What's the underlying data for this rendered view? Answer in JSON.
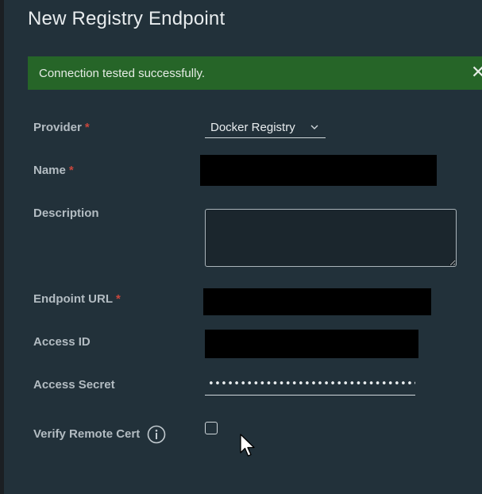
{
  "dialog": {
    "title": "New Registry Endpoint"
  },
  "alert": {
    "message": "Connection tested successfully.",
    "close_glyph": "✕",
    "color": "#266528"
  },
  "form": {
    "required_marker": "*",
    "provider": {
      "label": "Provider",
      "value": "Docker Registry"
    },
    "name": {
      "label": "Name"
    },
    "description": {
      "label": "Description",
      "value": ""
    },
    "endpoint_url": {
      "label": "Endpoint URL"
    },
    "access_id": {
      "label": "Access ID"
    },
    "access_secret": {
      "label": "Access Secret",
      "value": "••••••••••••••••••••••••••••••••••••••••"
    },
    "verify_remote_cert": {
      "label": "Verify Remote Cert",
      "checked": false
    }
  },
  "colors": {
    "panel_bg": "#22313a",
    "required": "#c8463c",
    "label": "#b3bcc2"
  },
  "icons": {
    "close": "close-icon",
    "chevron": "chevron-down-icon",
    "info": "info-icon",
    "cursor": "mouse-cursor-icon"
  }
}
